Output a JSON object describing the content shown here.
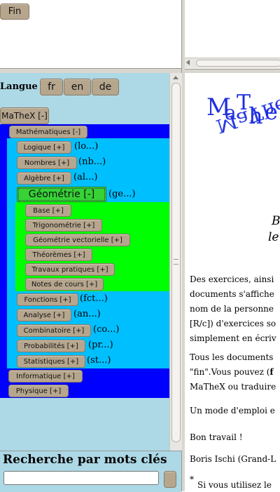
{
  "top": {
    "fin_label": "Fin"
  },
  "lang": {
    "label": "Langue",
    "fr": "fr",
    "en": "en",
    "de": "de"
  },
  "tree": {
    "mathex": "MaTheX [-]",
    "math": "Mathématiques [-]",
    "logique": "Logique [+]",
    "logique_abbr": "(lo...)",
    "nombres": "Nombres [+]",
    "nombres_abbr": "(nb...)",
    "algebre": "Algèbre [+]",
    "algebre_abbr": "(al...)",
    "geometrie": "Géométrie [-]",
    "geometrie_abbr": "(ge...)",
    "geo_items": [
      "Base [+]",
      "Trigonométrie [+]",
      "Géométrie vectorielle [+]",
      "Théorèmes [+]",
      "Travaux pratiques [+]",
      "Notes de cours [+]"
    ],
    "fonctions": "Fonctions [+]",
    "fonctions_abbr": "(fct...)",
    "analyse": "Analyse [+]",
    "analyse_abbr": "(an...)",
    "combinatoire": "Combinatoire [+]",
    "combinatoire_abbr": "(co...)",
    "probabilites": "Probabilités [+]",
    "probabilites_abbr": "(pr...)",
    "statistiques": "Statistiques [+]",
    "statistiques_abbr": "(st...)",
    "informatique": "Informatique [+]",
    "physique": "Physique [+]"
  },
  "search": {
    "heading": "Recherche par mots clés",
    "value": ""
  },
  "content": {
    "logo_text": "MaThe",
    "italic1": "B",
    "italic2": "le",
    "lines": [
      "Des exercices, ainsi",
      "documents s'affiche",
      "nom de la personne",
      "[R/c]) d'exercices so",
      "simplement en écriv"
    ],
    "para2_line1": "Tous les documents",
    "para2_line2_a": "\"fin\".Vous pouvez (",
    "para2_line2_b": "f",
    "para2_line3": "MaTheX ou traduire",
    "para3": "Un mode d'emploi e",
    "bon": "Bon travail !",
    "author": "Boris Ischi (Grand-L",
    "footnote_star": "*",
    "footnote": "Si vous utilisez le"
  },
  "colors": {
    "panel_bg": "#add8e6",
    "blue": "#0000ff",
    "cyan": "#00bfff",
    "green": "#00ff00",
    "button": "#b6a68e",
    "logo_blue": "#1f2fe0"
  }
}
